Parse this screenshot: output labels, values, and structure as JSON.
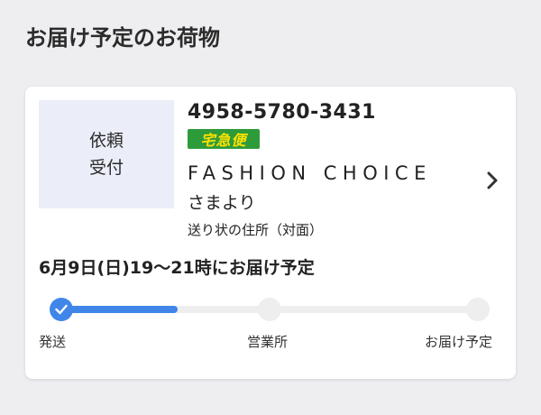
{
  "header": {
    "title": "お届け予定のお荷物"
  },
  "package": {
    "status": "依頼\n受付",
    "tracking_number": "4958-5780-3431",
    "service_label": "宅急便",
    "service_badge_color": "#2e9b3a",
    "service_text_color": "#ffe100",
    "sender": "FASHION CHOICE",
    "sender_suffix": "さまより",
    "address_note": "送り状の住所（対面）",
    "delivery_time": "6月9日(日)19〜21時にお届け予定",
    "chevron_icon": "chevron-right-icon"
  },
  "progress": {
    "accent_color": "#3f86e8",
    "current_step": 1,
    "fill_fraction": 0.28,
    "steps": [
      {
        "label": "発送",
        "done": true
      },
      {
        "label": "営業所",
        "done": false
      },
      {
        "label": "お届け予定",
        "done": false
      }
    ]
  }
}
